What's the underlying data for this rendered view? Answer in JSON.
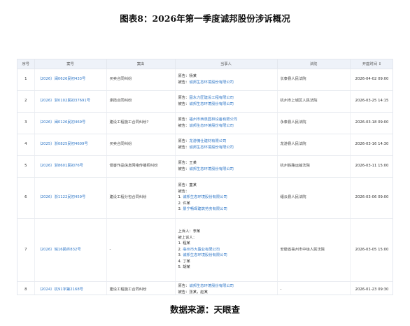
{
  "title": "图表8：2026年第一季度诚邦股份涉诉概况",
  "footer": "数据来源：天眼查",
  "table": {
    "headers": {
      "idx": "序号",
      "case_no": "案号",
      "cause": "案由",
      "parties": "当事人",
      "court": "法院",
      "date": "开庭时间 ↕"
    },
    "rows": [
      {
        "idx": "1",
        "case_no": "（2026）闽0626民初433号",
        "cause": "买卖合同纠纷",
        "parties": [
          {
            "prefix": "原告：",
            "name": "杨某",
            "link": false
          },
          {
            "prefix": "被告：",
            "name": "诚邦生态环境股份有限公司",
            "link": true
          }
        ],
        "court": "长泰县人民法院",
        "date": "2026-04-02 09:00"
      },
      {
        "idx": "2",
        "case_no": "（2026）浙0102民初37691号",
        "cause": "承揽合同纠纷",
        "parties": [
          {
            "prefix": "原告：",
            "name": "固永力匠建设工程有限公司",
            "link": true
          },
          {
            "prefix": "被告：",
            "name": "诚邦生态环境股份有限公司",
            "link": true
          }
        ],
        "court": "杭州市上城区人民法院",
        "date": "2026-03-25 14:15"
      },
      {
        "idx": "3",
        "case_no": "（2026）闽0126民初469号",
        "cause": "建设工程施工合同纠纷?",
        "parties": [
          {
            "prefix": "原告：",
            "name": "福州市西泉园林设备有限公司",
            "link": true
          },
          {
            "prefix": "被告：",
            "name": "诚邦生态环境股份有限公司",
            "link": true
          }
        ],
        "court": "永泰县人民法院",
        "date": "2026-03-18 09:00"
      },
      {
        "idx": "4",
        "case_no": "（2025）浙0825民初4609号",
        "cause": "买卖合同纠纷",
        "parties": [
          {
            "prefix": "原告：",
            "name": "龙游愧仕建材有限公司",
            "link": true
          },
          {
            "prefix": "被告：",
            "name": "诚邦生态环境股份有限公司",
            "link": true
          }
        ],
        "court": "龙游县人民法院",
        "date": "2026-03-16 14:30"
      },
      {
        "idx": "5",
        "case_no": "（2026）浙8601民初76号",
        "cause": "侵害作品信息网络传播权纠纷",
        "parties": [
          {
            "prefix": "原告：",
            "name": "王某",
            "link": false
          },
          {
            "prefix": "被告：",
            "name": "诚邦生态环境股份有限公司",
            "link": true
          }
        ],
        "court": "杭州铁路运输法院",
        "date": "2026-03-11 15:00"
      },
      {
        "idx": "6",
        "case_no": "（2026）浙1122民初459号",
        "cause": "建设工程分包合同纠纷",
        "parties": [
          {
            "prefix": "原告：",
            "name": "童某",
            "link": false
          },
          {
            "prefix": "被告：",
            "name": "",
            "link": false
          },
          {
            "prefix": "1. ",
            "name": "诚邦生态环境股份有限公司",
            "link": true
          },
          {
            "prefix": "2. ",
            "name": "许某",
            "link": false
          },
          {
            "prefix": "3. ",
            "name": "景宁畅琛建筑劳务有限公司",
            "link": true
          }
        ],
        "court": "缙云县人民法院",
        "date": "2026-03-06 09:00"
      },
      {
        "idx": "7",
        "case_no": "（2026）皖16民终832号",
        "cause": "-",
        "parties": [
          {
            "prefix": "上诉人：",
            "name": "李某",
            "link": false
          },
          {
            "prefix": "被上诉人：",
            "name": "",
            "link": false
          },
          {
            "prefix": "1. ",
            "name": "程某",
            "link": false
          },
          {
            "prefix": "2. ",
            "name": "亳州市大盈业有限公司",
            "link": true
          },
          {
            "prefix": "3. ",
            "name": "诚邦生态环境股份有限公司",
            "link": true
          },
          {
            "prefix": "4. ",
            "name": "丁某",
            "link": false
          },
          {
            "prefix": "5. ",
            "name": "胡某",
            "link": false
          }
        ],
        "court": "安徽省亳州市中级人民法院",
        "date": "2026-03-05 15:00"
      },
      {
        "idx": "8",
        "case_no": "（2024）杭91字第2168号",
        "cause": "建设工程施工合同纠纷",
        "parties": [
          {
            "prefix": "原告：",
            "name": "诚邦生态环境股份有限公司",
            "link": true
          },
          {
            "prefix": "被告：",
            "name": "张某，赵某",
            "link": false
          }
        ],
        "court": "-",
        "date": "2026-01-23 09:30"
      }
    ]
  }
}
